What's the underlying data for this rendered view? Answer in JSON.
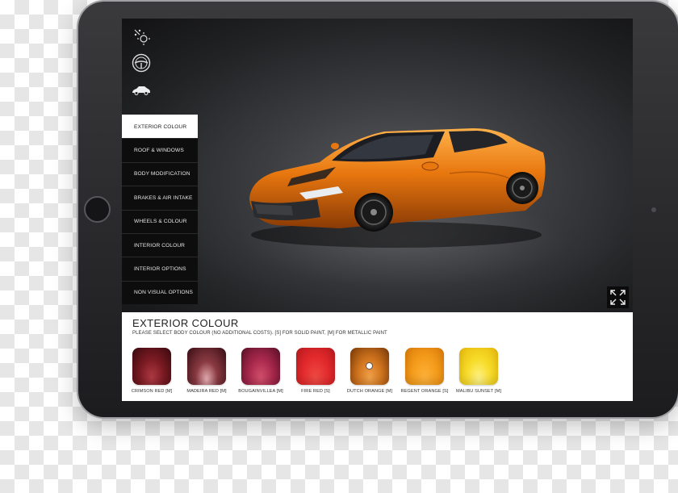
{
  "menu": {
    "items": [
      {
        "label": "EXTERIOR COLOUR",
        "active": true
      },
      {
        "label": "ROOF & WINDOWS",
        "active": false
      },
      {
        "label": "BODY MODIFICATION",
        "active": false
      },
      {
        "label": "BRAKES & AIR INTAKE",
        "active": false
      },
      {
        "label": "WHEELS & COLOUR",
        "active": false
      },
      {
        "label": "INTERIOR COLOUR",
        "active": false
      },
      {
        "label": "INTERIOR OPTIONS",
        "active": false
      },
      {
        "label": "NON VISUAL OPTIONS",
        "active": false
      }
    ]
  },
  "rail_icons": [
    "lighting-icon",
    "steering-wheel-icon",
    "car-side-icon"
  ],
  "panel": {
    "title": "EXTERIOR COLOUR",
    "subtitle": "PLEASE SELECT BODY COLOUR (NO ADDITIONAL COSTS). [S] FOR SOLID PAINT, [M] FOR METALLIC PAINT",
    "swatches": [
      {
        "label": "CRIMSON RED [M]",
        "color": "#7a1a22",
        "selected": false
      },
      {
        "label": "MADEIRA RED [M]",
        "color": "#6e2a30",
        "selected": false
      },
      {
        "label": "BOUGAINVILLEA [M]",
        "color": "#a8284c",
        "selected": false
      },
      {
        "label": "FIRE RED [S]",
        "color": "#e2292c",
        "selected": false
      },
      {
        "label": "DUTCH ORANGE [M]",
        "color": "#d0741e",
        "selected": true
      },
      {
        "label": "REGENT ORANGE [S]",
        "color": "#f39a1a",
        "selected": false
      },
      {
        "label": "MALIBU SUNSET [M]",
        "color": "#f7dc2a",
        "selected": false
      }
    ]
  },
  "colors": {
    "car_body": "#e8770f",
    "menu_bg": "#0d0d0e",
    "active_menu_bg": "#ffffff"
  }
}
